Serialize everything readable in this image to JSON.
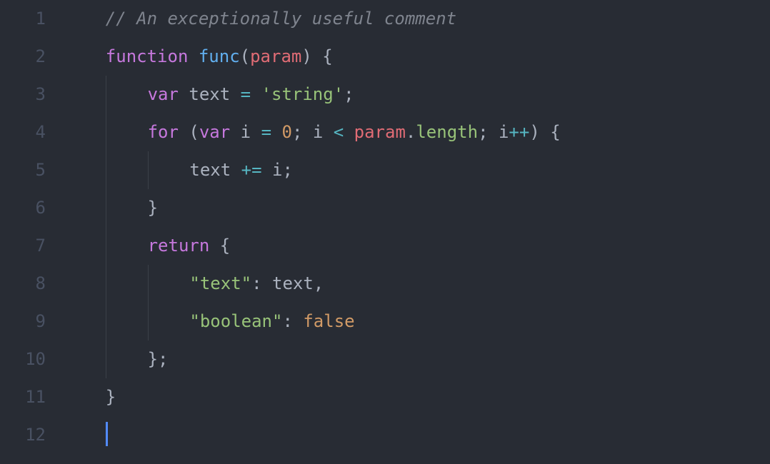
{
  "editor": {
    "lineNumbers": [
      "1",
      "2",
      "3",
      "4",
      "5",
      "6",
      "7",
      "8",
      "9",
      "10",
      "11",
      "12"
    ],
    "lines": [
      [
        {
          "cls": "",
          "text": "    "
        },
        {
          "cls": "comment",
          "text": "// An exceptionally useful comment"
        }
      ],
      [
        {
          "cls": "",
          "text": "    "
        },
        {
          "cls": "keyword",
          "text": "function"
        },
        {
          "cls": "",
          "text": " "
        },
        {
          "cls": "func-name",
          "text": "func"
        },
        {
          "cls": "paren",
          "text": "("
        },
        {
          "cls": "param",
          "text": "param"
        },
        {
          "cls": "paren",
          "text": ")"
        },
        {
          "cls": "",
          "text": " "
        },
        {
          "cls": "punct",
          "text": "{"
        }
      ],
      [
        {
          "cls": "",
          "text": "    "
        },
        {
          "cls": "indent-guide",
          "text": "    "
        },
        {
          "cls": "keyword",
          "text": "var"
        },
        {
          "cls": "",
          "text": " "
        },
        {
          "cls": "var-name",
          "text": "text"
        },
        {
          "cls": "",
          "text": " "
        },
        {
          "cls": "operator",
          "text": "="
        },
        {
          "cls": "",
          "text": " "
        },
        {
          "cls": "string",
          "text": "'string'"
        },
        {
          "cls": "punct",
          "text": ";"
        }
      ],
      [
        {
          "cls": "",
          "text": "    "
        },
        {
          "cls": "indent-guide",
          "text": "    "
        },
        {
          "cls": "keyword",
          "text": "for"
        },
        {
          "cls": "",
          "text": " "
        },
        {
          "cls": "paren",
          "text": "("
        },
        {
          "cls": "keyword",
          "text": "var"
        },
        {
          "cls": "",
          "text": " "
        },
        {
          "cls": "var-name",
          "text": "i"
        },
        {
          "cls": "",
          "text": " "
        },
        {
          "cls": "operator",
          "text": "="
        },
        {
          "cls": "",
          "text": " "
        },
        {
          "cls": "number",
          "text": "0"
        },
        {
          "cls": "punct",
          "text": ";"
        },
        {
          "cls": "",
          "text": " "
        },
        {
          "cls": "var-name",
          "text": "i"
        },
        {
          "cls": "",
          "text": " "
        },
        {
          "cls": "operator",
          "text": "<"
        },
        {
          "cls": "",
          "text": " "
        },
        {
          "cls": "identifier",
          "text": "param"
        },
        {
          "cls": "punct",
          "text": "."
        },
        {
          "cls": "member",
          "text": "length"
        },
        {
          "cls": "punct",
          "text": ";"
        },
        {
          "cls": "",
          "text": " "
        },
        {
          "cls": "var-name",
          "text": "i"
        },
        {
          "cls": "operator",
          "text": "++"
        },
        {
          "cls": "paren",
          "text": ")"
        },
        {
          "cls": "",
          "text": " "
        },
        {
          "cls": "punct",
          "text": "{"
        }
      ],
      [
        {
          "cls": "",
          "text": "    "
        },
        {
          "cls": "indent-guide",
          "text": "    "
        },
        {
          "cls": "indent-guide",
          "text": "    "
        },
        {
          "cls": "var-name",
          "text": "text"
        },
        {
          "cls": "",
          "text": " "
        },
        {
          "cls": "operator",
          "text": "+="
        },
        {
          "cls": "",
          "text": " "
        },
        {
          "cls": "var-name",
          "text": "i"
        },
        {
          "cls": "punct",
          "text": ";"
        }
      ],
      [
        {
          "cls": "",
          "text": "    "
        },
        {
          "cls": "indent-guide",
          "text": "    "
        },
        {
          "cls": "punct",
          "text": "}"
        }
      ],
      [
        {
          "cls": "",
          "text": "    "
        },
        {
          "cls": "indent-guide",
          "text": "    "
        },
        {
          "cls": "keyword",
          "text": "return"
        },
        {
          "cls": "",
          "text": " "
        },
        {
          "cls": "punct",
          "text": "{"
        }
      ],
      [
        {
          "cls": "",
          "text": "    "
        },
        {
          "cls": "indent-guide",
          "text": "    "
        },
        {
          "cls": "indent-guide",
          "text": "    "
        },
        {
          "cls": "string",
          "text": "\"text\""
        },
        {
          "cls": "punct",
          "text": ":"
        },
        {
          "cls": "",
          "text": " "
        },
        {
          "cls": "var-name",
          "text": "text"
        },
        {
          "cls": "punct",
          "text": ","
        }
      ],
      [
        {
          "cls": "",
          "text": "    "
        },
        {
          "cls": "indent-guide",
          "text": "    "
        },
        {
          "cls": "indent-guide",
          "text": "    "
        },
        {
          "cls": "string",
          "text": "\"boolean\""
        },
        {
          "cls": "punct",
          "text": ":"
        },
        {
          "cls": "",
          "text": " "
        },
        {
          "cls": "literal",
          "text": "false"
        }
      ],
      [
        {
          "cls": "",
          "text": "    "
        },
        {
          "cls": "indent-guide",
          "text": "    "
        },
        {
          "cls": "punct",
          "text": "};"
        }
      ],
      [
        {
          "cls": "",
          "text": "    "
        },
        {
          "cls": "punct",
          "text": "}"
        }
      ],
      [
        {
          "cls": "",
          "text": "    "
        },
        {
          "cls": "cursor",
          "text": ""
        }
      ]
    ]
  }
}
